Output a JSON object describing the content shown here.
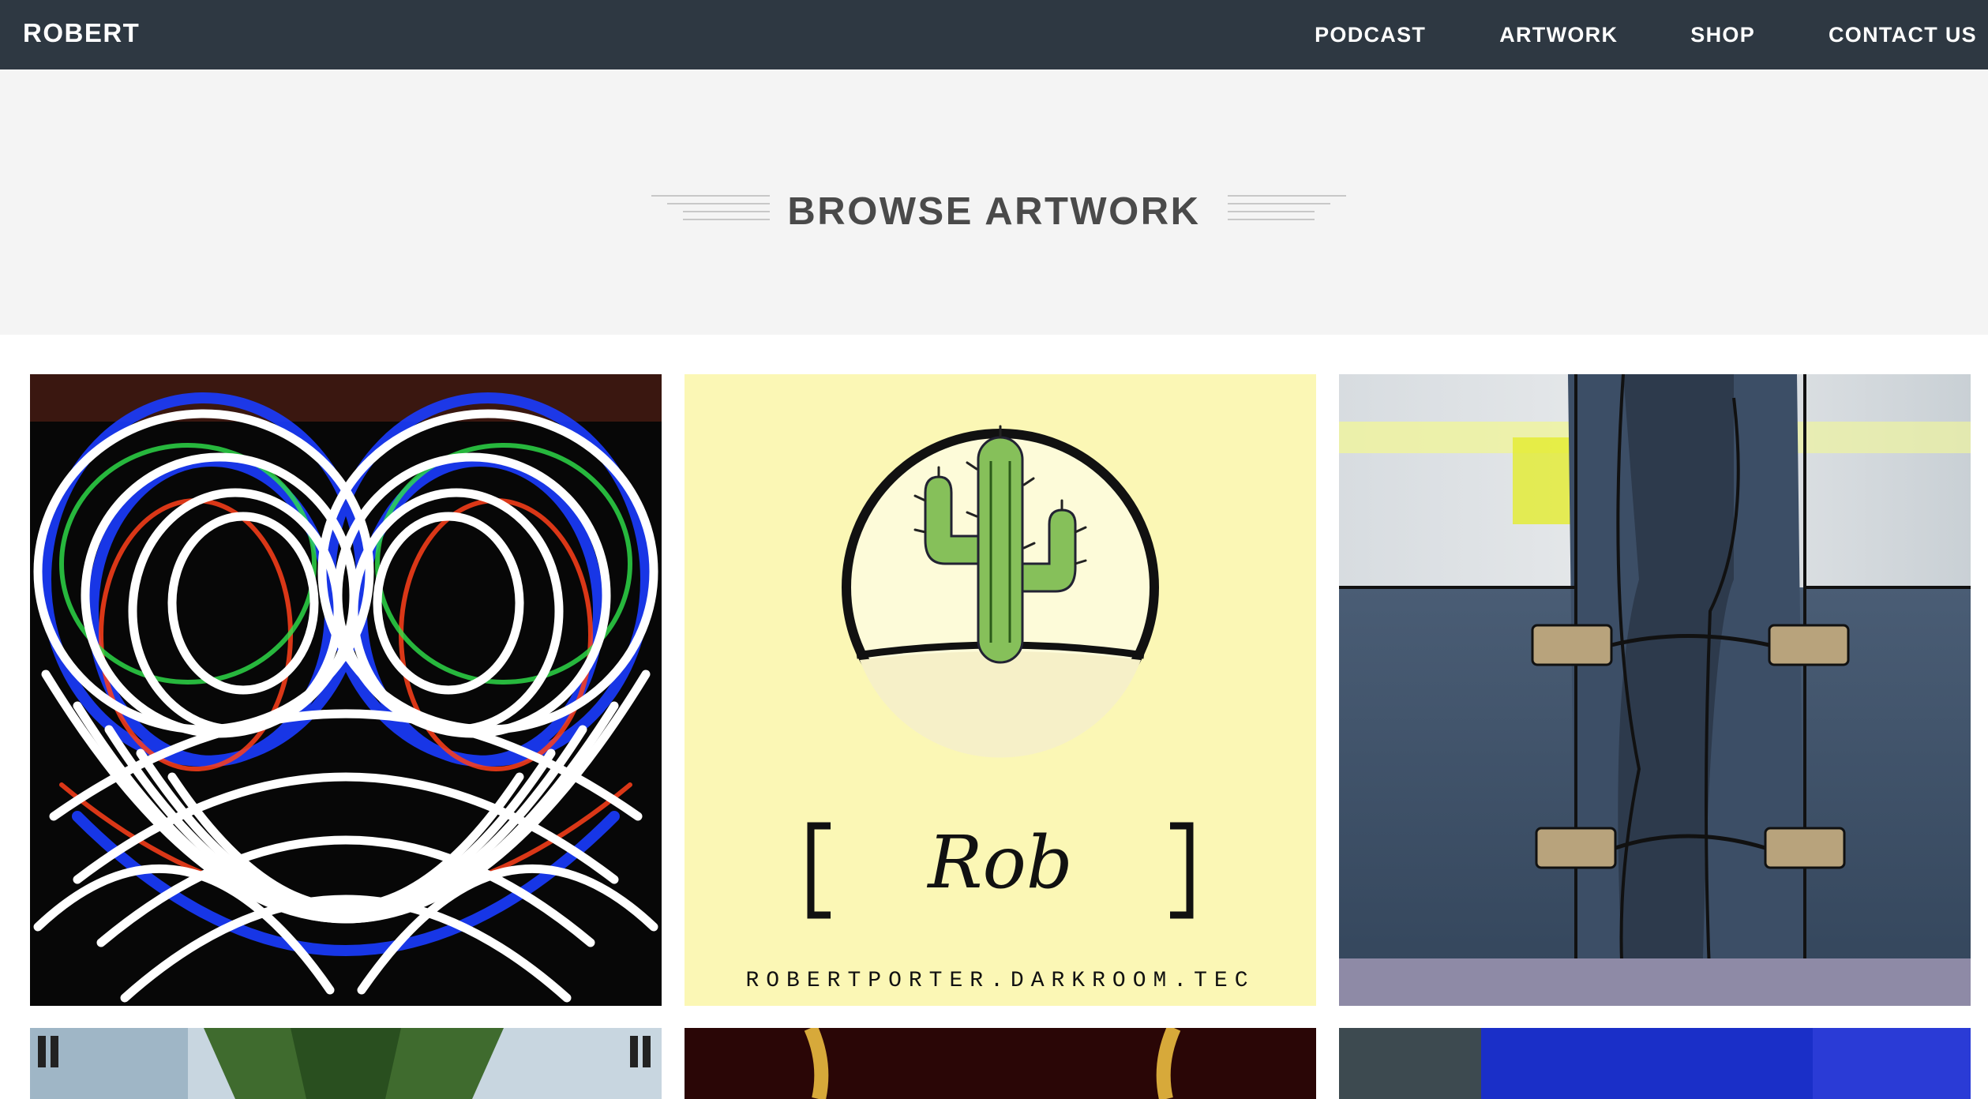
{
  "header": {
    "brand": "ROBERT",
    "nav": [
      {
        "label": "PODCAST"
      },
      {
        "label": "ARTWORK"
      },
      {
        "label": "SHOP"
      },
      {
        "label": "CONTACT US"
      }
    ]
  },
  "hero": {
    "title": "BROWSE ARTWORK"
  },
  "gallery": {
    "items": [
      {
        "name": "light-painting-artwork"
      },
      {
        "name": "cactus-logo-artwork",
        "text_rob": "Rob",
        "text_url": "ROBERTPORTER.DARKROOM.TEC"
      },
      {
        "name": "industrial-wall-artwork"
      },
      {
        "name": "palm-tree-artwork"
      },
      {
        "name": "gold-chain-artwork"
      },
      {
        "name": "blue-abstract-artwork"
      }
    ]
  },
  "colors": {
    "topbar": "#2e3842",
    "hero_bg": "#f4f4f4",
    "title": "#4a4a4a",
    "cactus_bg": "#fbf7b5"
  }
}
